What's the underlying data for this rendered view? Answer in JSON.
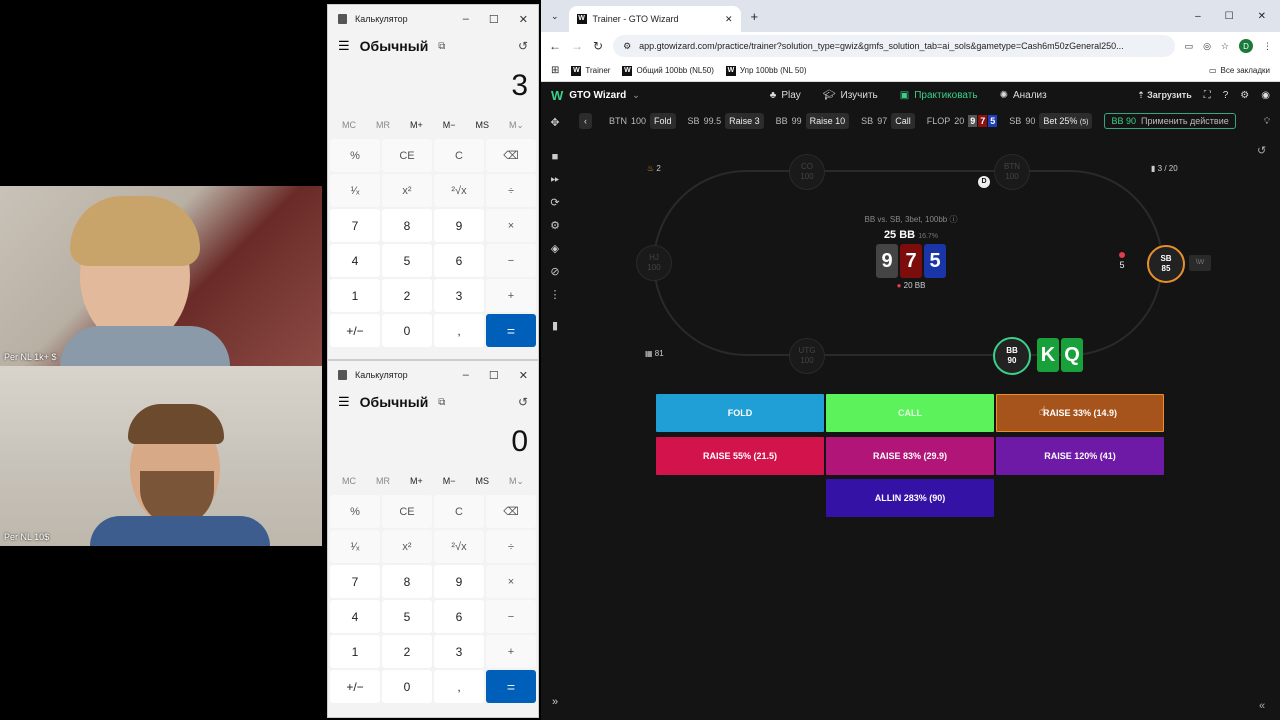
{
  "cams": {
    "top_label": "Per NL 1k+ $",
    "bottom_label": "Per NL 10$"
  },
  "calc_top": {
    "title": "Калькулятор",
    "mode": "Обычный",
    "display": "3",
    "mem": [
      "MC",
      "MR",
      "M+",
      "M−",
      "MS",
      "M⌄"
    ],
    "keys": [
      "%",
      "CE",
      "C",
      "⌫",
      "¹⁄ₓ",
      "x²",
      "²√x",
      "÷",
      "7",
      "8",
      "9",
      "×",
      "4",
      "5",
      "6",
      "−",
      "1",
      "2",
      "3",
      "+",
      "+/−",
      "0",
      ",",
      "="
    ]
  },
  "calc_bottom": {
    "title": "Калькулятор",
    "mode": "Обычный",
    "display": "0",
    "mem": [
      "MC",
      "MR",
      "M+",
      "M−",
      "MS",
      "M⌄"
    ],
    "keys": [
      "%",
      "CE",
      "C",
      "⌫",
      "¹⁄ₓ",
      "x²",
      "²√x",
      "÷",
      "7",
      "8",
      "9",
      "×",
      "4",
      "5",
      "6",
      "−",
      "1",
      "2",
      "3",
      "+",
      "+/−",
      "0",
      ",",
      "="
    ]
  },
  "browser": {
    "tab_title": "Trainer - GTO Wizard",
    "url": "app.gtowizard.com/practice/trainer?solution_type=gwiz&gmfs_solution_tab=ai_sols&gametype=Cash6m50zGeneral250...",
    "profile": "D",
    "bookmarks": [
      "Trainer",
      "Общий 100bb (NL50)",
      "Упр 100bb (NL 50)"
    ],
    "all_bookmarks": "Все закладки"
  },
  "gto": {
    "brand": "GTO Wizard",
    "nav": [
      "Play",
      "Изучить",
      "Практиковать",
      "Анализ"
    ],
    "upload": "Загрузить",
    "actions": [
      {
        "pos": "BTN",
        "stack": "100",
        "act": "Fold"
      },
      {
        "pos": "SB",
        "stack": "99.5",
        "act": "Raise 3"
      },
      {
        "pos": "BB",
        "stack": "99",
        "act": "Raise 10"
      },
      {
        "pos": "SB",
        "stack": "97",
        "act": "Call"
      }
    ],
    "flop": {
      "label": "FLOP",
      "value": "20",
      "cards": [
        "9",
        "7",
        "5"
      ]
    },
    "sb_bet": {
      "pos": "SB",
      "stack": "90",
      "act": "Bet 25%",
      "size": "(5)"
    },
    "apply": {
      "pos": "BB",
      "stack": "90",
      "label": "Применить действие"
    },
    "streak": "2",
    "progress": "3 / 20",
    "hands": "81",
    "spot": "BB vs. SB, 3bet, 100bb ⓘ",
    "pot": "25 BB",
    "pot_pct": "16.7%",
    "board": [
      "9",
      "7",
      "5"
    ],
    "sb_chips": "20 BB",
    "sb_bet_chip": "5",
    "seats": {
      "co": [
        "CO",
        "100"
      ],
      "btn": [
        "BTN",
        "100"
      ],
      "hj": [
        "HJ",
        "100"
      ],
      "utg": [
        "UTG",
        "100"
      ],
      "sb": [
        "SB",
        "85"
      ],
      "bb": [
        "BB",
        "90"
      ]
    },
    "dealer": "D",
    "hero_cards": [
      "K",
      "Q"
    ],
    "buttons": {
      "fold": "FOLD",
      "call": "CALL",
      "r33": "RAISE 33% (14.9)",
      "r55": "RAISE 55% (21.5)",
      "r83": "RAISE 83% (29.9)",
      "r120": "RAISE 120% (41)",
      "allin": "ALLIN 283% (90)"
    },
    "colors": {
      "fold": "#1f9fd6",
      "call": "#5cf25c",
      "raise33": "#a6531c",
      "raise55": "#d3134b",
      "raise83": "#b11578",
      "raise120": "#6e1aa6",
      "allin": "#3512a6",
      "accent": "#3ad08a"
    }
  }
}
